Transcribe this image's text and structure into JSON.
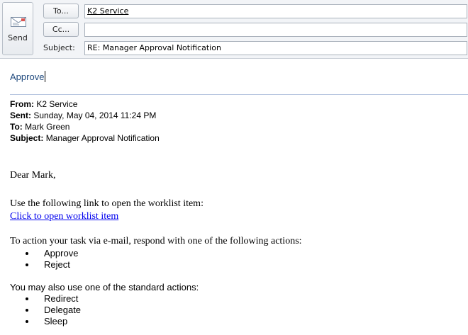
{
  "toolbar": {
    "send_label": "Send",
    "to_button": "To...",
    "cc_button": "Cc...",
    "subject_label": "Subject:"
  },
  "fields": {
    "to_value": "K2 Service",
    "cc_value": "",
    "subject_value": "RE: Manager Approval Notification"
  },
  "body": {
    "reply_text": "Approve",
    "original": {
      "from_label": "From:",
      "from_value": "K2 Service",
      "sent_label": "Sent:",
      "sent_value": "Sunday, May 04, 2014 11:24 PM",
      "to_label": "To:",
      "to_value": "Mark Green",
      "subject_label": "Subject:",
      "subject_value": "Manager Approval Notification"
    },
    "greeting": "Dear Mark,",
    "link_intro": "Use the following link to open the worklist item:",
    "link_text": "Click to open worklist item",
    "action_intro": "To action your task via e-mail, respond with one of the following actions:",
    "actions": [
      "Approve",
      "Reject"
    ],
    "standard_intro": "You may also use one of the standard actions:",
    "standard_actions": [
      "Redirect",
      "Delegate",
      "Sleep"
    ]
  },
  "colors": {
    "reply_text": "#1f497d",
    "link": "#0000ee"
  },
  "icons": {
    "send": "envelope-send-icon"
  }
}
